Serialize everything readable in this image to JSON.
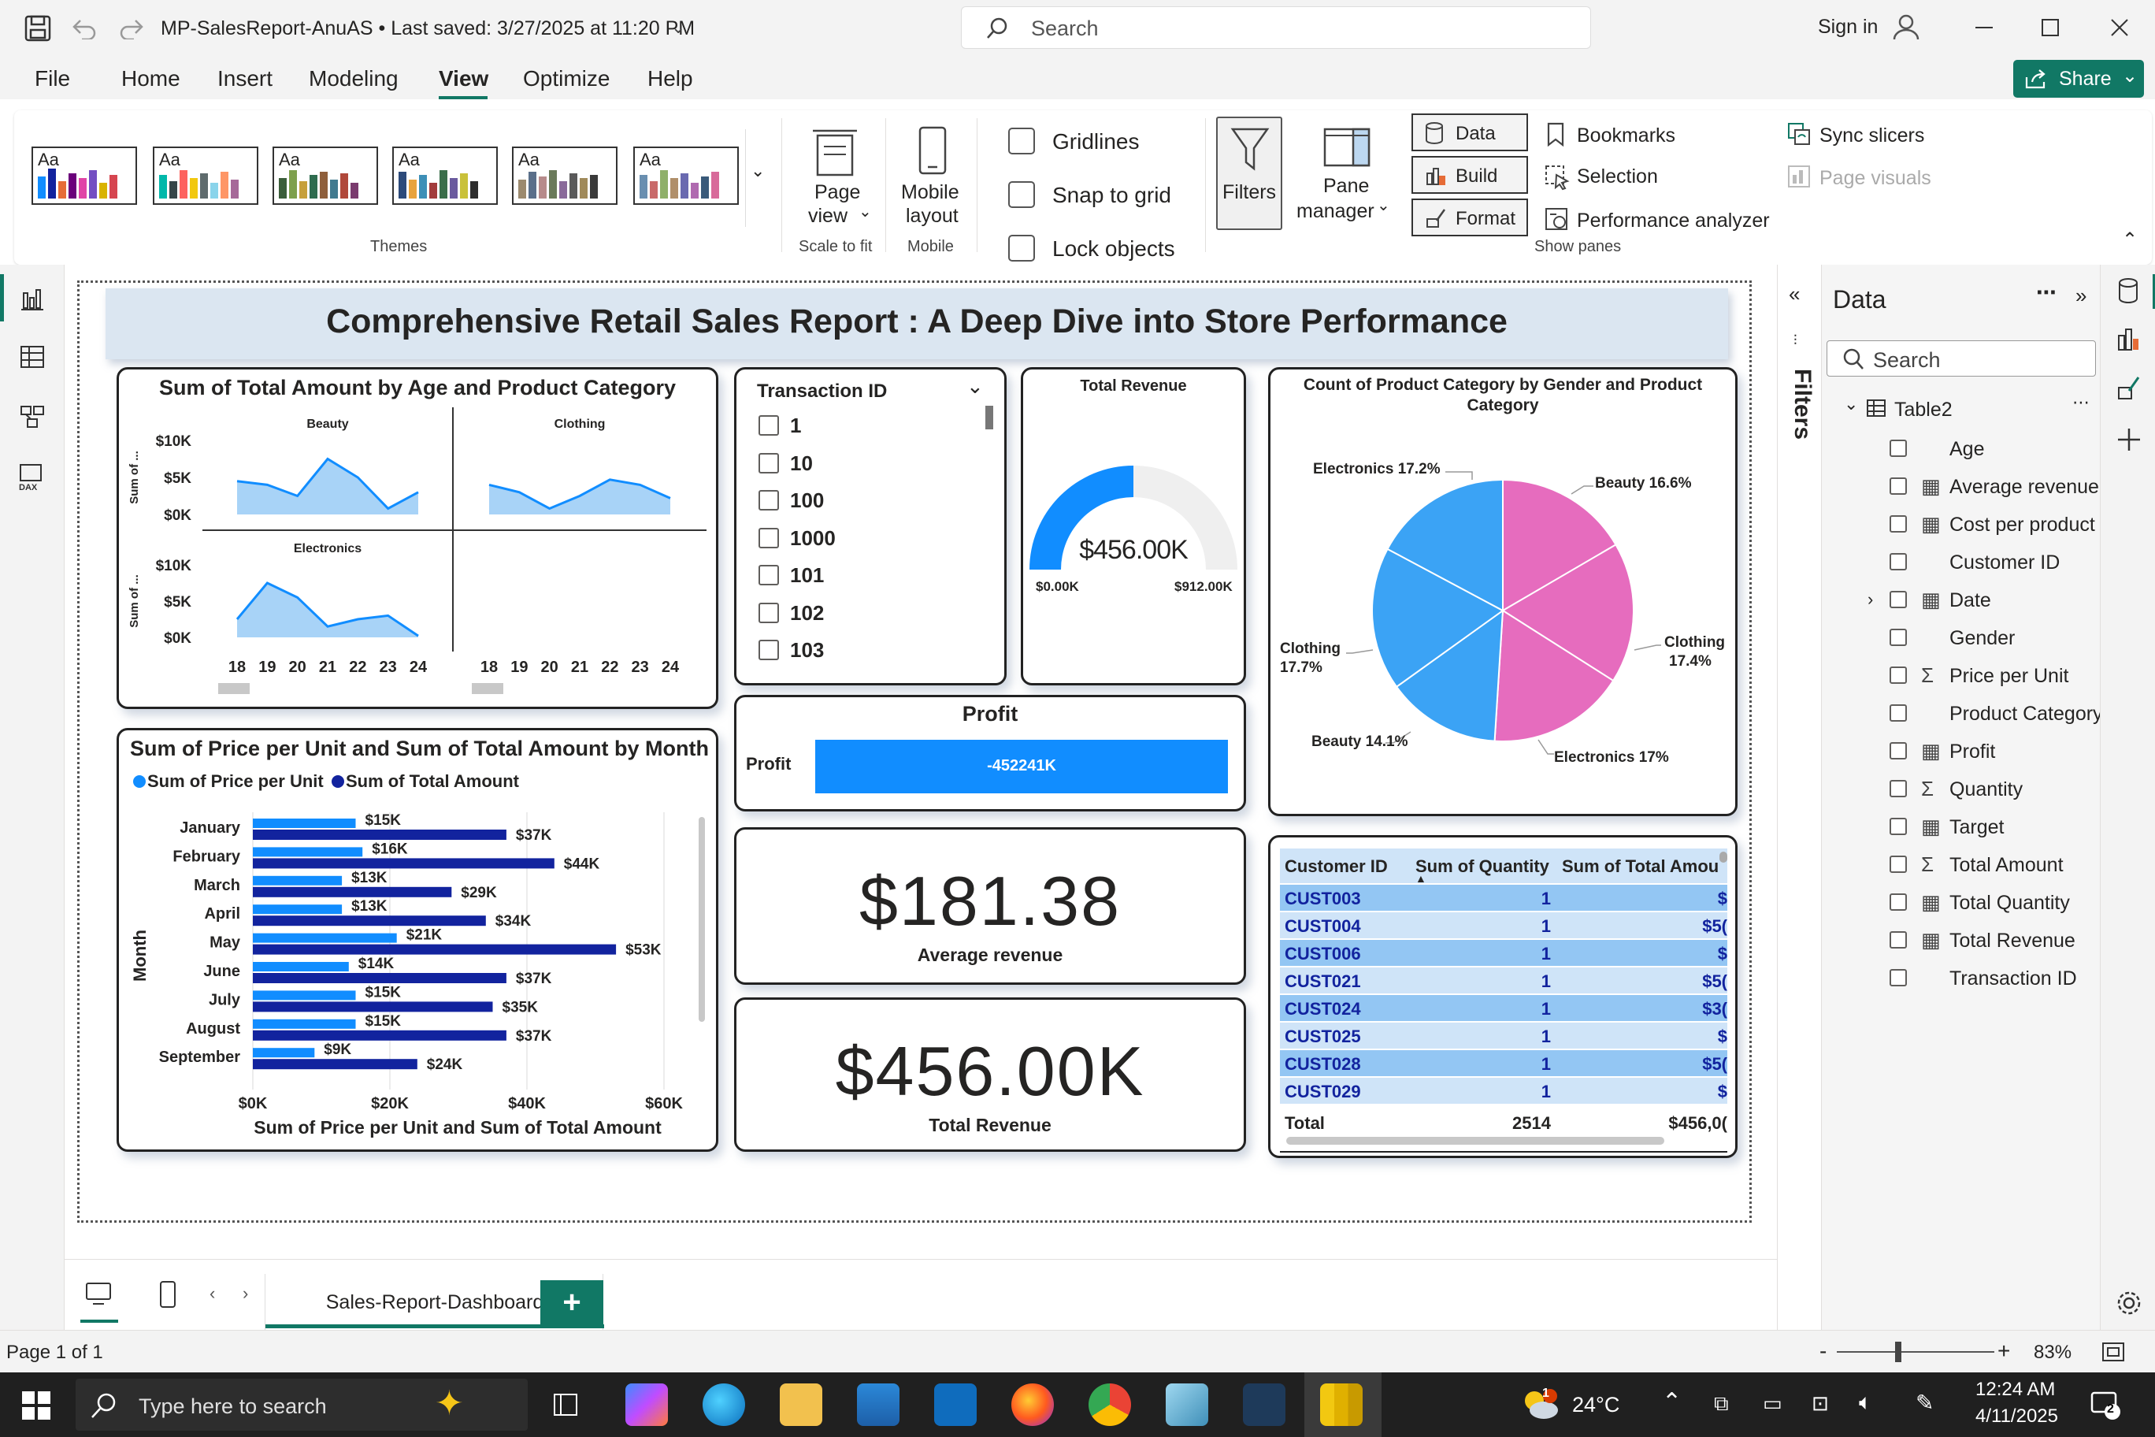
{
  "window": {
    "title": "MP-SalesReport-AnuAS • Last saved: 3/27/2025 at 11:20 PM",
    "search_placeholder": "Search",
    "sign_in": "Sign in"
  },
  "menu": {
    "items": [
      "File",
      "Home",
      "Insert",
      "Modeling",
      "View",
      "Optimize",
      "Help"
    ],
    "active": "View",
    "share": "Share"
  },
  "ribbon": {
    "themes_label": "Themes",
    "theme_aa": "Aa",
    "page_view": "Page view",
    "page_view_line1": "Page",
    "page_view_line2": "view",
    "scale_to_fit": "Scale to fit",
    "mobile_layout_line1": "Mobile",
    "mobile_layout_line2": "layout",
    "mobile": "Mobile",
    "gridlines": "Gridlines",
    "snap_to_grid": "Snap to grid",
    "lock_objects": "Lock objects",
    "filters": "Filters",
    "pane_manager_line1": "Pane",
    "pane_manager_line2": "manager",
    "data": "Data",
    "build": "Build",
    "format": "Format",
    "bookmarks": "Bookmarks",
    "selection": "Selection",
    "performance_analyzer": "Performance analyzer",
    "sync_slicers": "Sync slicers",
    "page_visuals": "Page visuals",
    "show_panes": "Show panes"
  },
  "report": {
    "title": "Comprehensive Retail Sales Report : A Deep Dive into Store Performance"
  },
  "visual_age": {
    "title": "Sum of Total Amount by Age and Product Category",
    "y_label": "Sum of ...",
    "panels": [
      "Beauty",
      "Clothing",
      "Electronics"
    ],
    "y_ticks": [
      "$10K",
      "$5K",
      "$0K"
    ],
    "x_ticks": [
      "18",
      "19",
      "20",
      "21",
      "22",
      "23",
      "24"
    ]
  },
  "slicer": {
    "title": "Transaction ID",
    "items": [
      "1",
      "10",
      "100",
      "1000",
      "101",
      "102",
      "103"
    ]
  },
  "gauge": {
    "title": "Total Revenue",
    "value_label": "$456.00K",
    "min_label": "$0.00K",
    "max_label": "$912.00K"
  },
  "pie": {
    "title_line1": "Count of Product Category by Gender and Product",
    "title_line2": "Category",
    "labels": {
      "electronics_a": "Electronics 17.2%",
      "beauty_a": "Beauty 16.6%",
      "clothing_a_line1": "Clothing",
      "clothing_a_line2": "17.4%",
      "clothing_b_line1": "Clothing",
      "clothing_b_line2": "17.7%",
      "beauty_b": "Beauty 14.1%",
      "electronics_b": "Electronics 17%"
    }
  },
  "profit": {
    "title": "Profit",
    "label": "Profit",
    "value": "-452241K"
  },
  "avg_card": {
    "value": "$181.38",
    "label": "Average revenue"
  },
  "rev_card": {
    "value": "$456.00K",
    "label": "Total Revenue"
  },
  "bar_visual": {
    "title": "Sum of Price per Unit and Sum of Total Amount by Month",
    "legend": [
      "Sum of Price per Unit",
      "Sum of Total Amount"
    ],
    "y_label": "Month",
    "x_label": "Sum of Price per Unit and Sum of Total Amount",
    "x_ticks": [
      "$0K",
      "$20K",
      "$40K",
      "$60K"
    ]
  },
  "table": {
    "headers": [
      "Customer ID",
      "Sum of Quantity",
      "Sum of Total Amou"
    ],
    "rows": [
      [
        "CUST003",
        "1",
        "$"
      ],
      [
        "CUST004",
        "1",
        "$5("
      ],
      [
        "CUST006",
        "1",
        "$"
      ],
      [
        "CUST021",
        "1",
        "$5("
      ],
      [
        "CUST024",
        "1",
        "$3("
      ],
      [
        "CUST025",
        "1",
        "$"
      ],
      [
        "CUST028",
        "1",
        "$5("
      ],
      [
        "CUST029",
        "1",
        "$"
      ]
    ],
    "total": [
      "Total",
      "2514",
      "$456,0("
    ]
  },
  "data_pane": {
    "title": "Data",
    "search_placeholder": "Search",
    "table_name": "Table2",
    "fields": [
      {
        "name": "Age",
        "icon": ""
      },
      {
        "name": "Average revenue",
        "icon": "calculator-icon"
      },
      {
        "name": "Cost per product",
        "icon": "calculator-icon"
      },
      {
        "name": "Customer ID",
        "icon": ""
      },
      {
        "name": "Date",
        "icon": "calendar-icon"
      },
      {
        "name": "Gender",
        "icon": ""
      },
      {
        "name": "Price per Unit",
        "icon": "sigma-icon"
      },
      {
        "name": "Product Category",
        "icon": ""
      },
      {
        "name": "Profit",
        "icon": "calculator-icon"
      },
      {
        "name": "Quantity",
        "icon": "sigma-icon"
      },
      {
        "name": "Target",
        "icon": "calculator-icon"
      },
      {
        "name": "Total Amount",
        "icon": "sigma-icon"
      },
      {
        "name": "Total Quantity",
        "icon": "calculator-icon"
      },
      {
        "name": "Total Revenue",
        "icon": "calculator-icon"
      },
      {
        "name": "Transaction ID",
        "icon": ""
      }
    ]
  },
  "filters_label": "Filters",
  "tabs": {
    "active_tab": "Sales-Report-Dashboard",
    "add": "+"
  },
  "status": {
    "page": "Page 1 of 1",
    "zoom": "83%",
    "minus": "-",
    "plus": "+"
  },
  "taskbar": {
    "search_placeholder": "Type here to search",
    "weather": "24°C",
    "weather_badge": "1",
    "time": "12:24 AM",
    "date": "4/11/2025",
    "notif_count": "2"
  },
  "chart_data": [
    {
      "type": "area",
      "title": "Sum of Total Amount by Age and Product Category",
      "xlabel": "",
      "ylabel": "Sum of ...",
      "x": [
        18,
        19,
        20,
        21,
        22,
        23,
        24
      ],
      "ylim": [
        0,
        10000
      ],
      "series": [
        {
          "name": "Beauty",
          "values": [
            4500,
            4000,
            2500,
            7500,
            5000,
            800,
            3000
          ]
        },
        {
          "name": "Clothing",
          "values": [
            4000,
            3000,
            800,
            2500,
            4700,
            4000,
            2200
          ]
        },
        {
          "name": "Electronics",
          "values": [
            2500,
            7500,
            5500,
            1500,
            2500,
            3000,
            200
          ]
        }
      ]
    },
    {
      "type": "bar",
      "title": "Sum of Price per Unit and Sum of Total Amount by Month",
      "xlabel": "Sum of Price per Unit and Sum of Total Amount",
      "ylabel": "Month",
      "categories": [
        "January",
        "February",
        "March",
        "April",
        "May",
        "June",
        "July",
        "August",
        "September"
      ],
      "xlim": [
        0,
        60000
      ],
      "series": [
        {
          "name": "Sum of Price per Unit",
          "values": [
            15000,
            16000,
            13000,
            13000,
            21000,
            14000,
            15000,
            15000,
            9000
          ],
          "labels": [
            "$15K",
            "$16K",
            "$13K",
            "$13K",
            "$21K",
            "$14K",
            "$15K",
            "$15K",
            "$9K"
          ]
        },
        {
          "name": "Sum of Total Amount",
          "values": [
            37000,
            44000,
            29000,
            34000,
            53000,
            37000,
            35000,
            37000,
            24000
          ],
          "labels": [
            "$37K",
            "$44K",
            "$29K",
            "$34K",
            "$53K",
            "$37K",
            "$35K",
            "$37K",
            "$24K"
          ]
        }
      ]
    },
    {
      "type": "pie",
      "title": "Count of Product Category by Gender and Product Category",
      "slices": [
        {
          "label": "Beauty",
          "value": 16.6,
          "color": "#e66cbe"
        },
        {
          "label": "Clothing",
          "value": 17.4,
          "color": "#e66cbe"
        },
        {
          "label": "Electronics",
          "value": 17.0,
          "color": "#e66cbe"
        },
        {
          "label": "Beauty",
          "value": 14.1,
          "color": "#3ba3f5"
        },
        {
          "label": "Clothing",
          "value": 17.7,
          "color": "#3ba3f5"
        },
        {
          "label": "Electronics",
          "value": 17.2,
          "color": "#3ba3f5"
        }
      ]
    },
    {
      "type": "gauge",
      "title": "Total Revenue",
      "value": 456000,
      "min": 0,
      "max": 912000
    }
  ],
  "colors": {
    "accent_green": "#117865",
    "light_blue": "#118dff",
    "dark_blue": "#12239e",
    "area_fill": "#a8d3f7",
    "area_line": "#118dff",
    "table_row_a": "#93c6f3",
    "table_row_b": "#cfe4f8",
    "pink": "#e66cbe",
    "pie_blue": "#3ba3f5",
    "profit_bar": "#118dff",
    "title_banner": "#dbe6f1"
  }
}
